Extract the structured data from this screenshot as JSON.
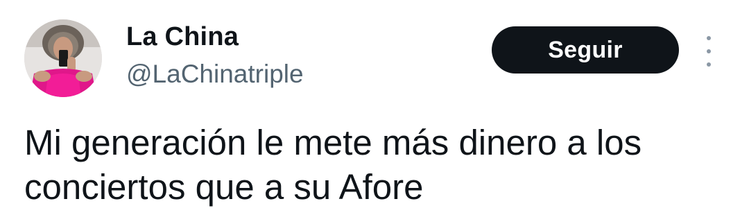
{
  "author": {
    "display_name": "La China",
    "handle": "@LaChinatriple"
  },
  "actions": {
    "follow_label": "Seguir",
    "more_icon": "more-vertical-icon"
  },
  "tweet": {
    "text": "Mi generación le mete más dinero a los\nconciertos que a su Afore"
  },
  "colors": {
    "text_primary": "#0f1419",
    "text_secondary": "#536471",
    "follow_button_bg": "#0f1419",
    "follow_button_text": "#ffffff",
    "background": "#ffffff"
  }
}
